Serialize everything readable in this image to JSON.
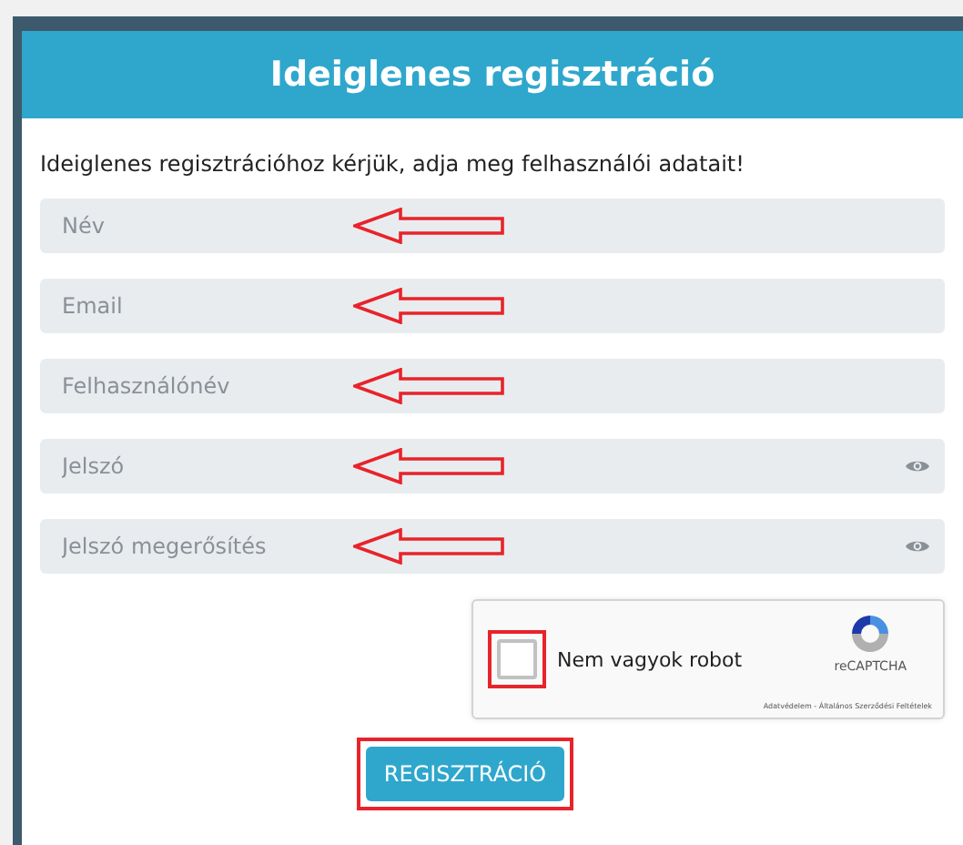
{
  "card": {
    "title": "Ideiglenes regisztráció",
    "intro": "Ideiglenes regisztrációhoz kérjük, adja meg felhasználói adatait!"
  },
  "fields": [
    {
      "placeholder": "Név",
      "kind": "text",
      "arrow": true
    },
    {
      "placeholder": "Email",
      "kind": "text",
      "arrow": true
    },
    {
      "placeholder": "Felhasználónév",
      "kind": "text",
      "arrow": true
    },
    {
      "placeholder": "Jelszó",
      "kind": "password",
      "arrow": true
    },
    {
      "placeholder": "Jelszó megerősítés",
      "kind": "password",
      "arrow": true
    }
  ],
  "captcha": {
    "label": "Nem vagyok robot",
    "checked": false,
    "highlighted": true,
    "brand": "reCAPTCHA",
    "footer": "Adatvédelem - Általános Szerződési Feltételek"
  },
  "submit": {
    "label": "REGISZTRÁCIÓ",
    "highlighted": true
  }
}
